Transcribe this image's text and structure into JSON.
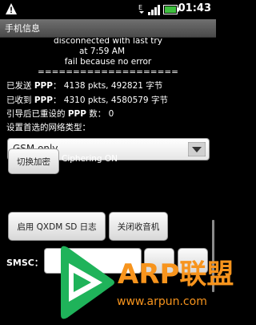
{
  "status_bar": {
    "time": "01:43",
    "icons": [
      "warning-icon",
      "data-transfer-icon",
      "signal-icon",
      "battery-icon"
    ]
  },
  "title_bar": {
    "title": "手机信息"
  },
  "info": {
    "line1": "disconnected with last try",
    "line2": "at 7:59 AM",
    "line3": "fail because no error",
    "divider": "====================",
    "sent_label_pre": "已发送 ",
    "sent_label_ppp": "PPP",
    "sent_value": "：  4138 pkts, 492821 字节",
    "recv_label_pre": "已收到 ",
    "recv_label_ppp": "PPP",
    "recv_value": "：  4310 pkts, 4580579 字节",
    "reset_label_pre": "引导后已重设的 ",
    "reset_label_ppp": "PPP",
    "reset_value": " 数：  0",
    "network_type_label": "设置首选的网络类型："
  },
  "network_spinner": {
    "value": "GSM only"
  },
  "buttons": {
    "toggle_cipher": "切换加密",
    "ciphering_status": "Ciphering ON",
    "enable_qxdm": "启用 QXDM SD 日志",
    "close_radio": "关闭收音机"
  },
  "smsc": {
    "label": "SMSC：",
    "value": ""
  },
  "watermark": {
    "title": "ARP联盟",
    "url": "www.arpun.com"
  }
}
